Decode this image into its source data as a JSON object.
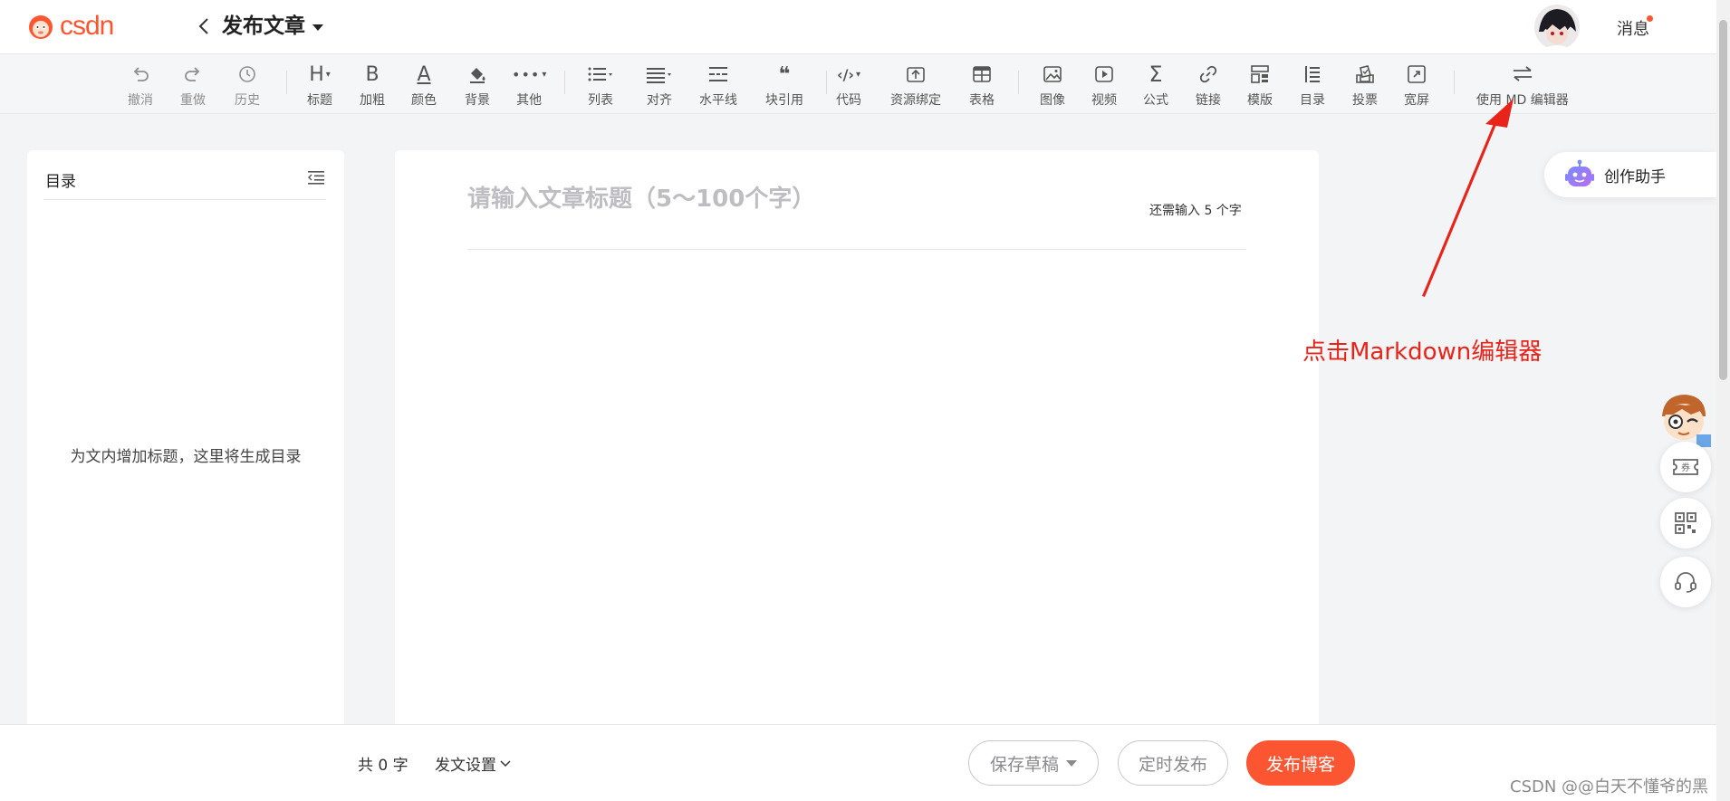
{
  "header": {
    "logo_text": "CSDN",
    "page_title": "发布文章",
    "messages_label": "消息"
  },
  "toolbar": [
    {
      "name": "undo",
      "label": "撤消",
      "icon": "undo-icon",
      "disabled": true
    },
    {
      "name": "redo",
      "label": "重做",
      "icon": "redo-icon",
      "disabled": true
    },
    {
      "name": "history",
      "label": "历史",
      "icon": "history-icon",
      "disabled": true
    },
    {
      "name": "heading",
      "label": "标题",
      "icon": "heading-icon",
      "glyph": "H",
      "dropdown": true
    },
    {
      "name": "bold",
      "label": "加粗",
      "icon": "bold-icon",
      "glyph": "B"
    },
    {
      "name": "color",
      "label": "颜色",
      "icon": "text-color-icon",
      "glyph": "A"
    },
    {
      "name": "background",
      "label": "背景",
      "icon": "paint-bucket-icon"
    },
    {
      "name": "other",
      "label": "其他",
      "icon": "more-icon",
      "glyph": "•••",
      "dropdown": true
    },
    {
      "name": "list",
      "label": "列表",
      "icon": "list-icon",
      "dropdown": true
    },
    {
      "name": "align",
      "label": "对齐",
      "icon": "align-icon",
      "dropdown": true
    },
    {
      "name": "hr",
      "label": "水平线",
      "icon": "horizontal-rule-icon"
    },
    {
      "name": "blockquote",
      "label": "块引用",
      "icon": "quote-icon",
      "glyph": "❝"
    },
    {
      "name": "code",
      "label": "代码",
      "icon": "code-icon",
      "glyph": "‹/›",
      "dropdown": true
    },
    {
      "name": "resource",
      "label": "资源绑定",
      "icon": "resource-upload-icon"
    },
    {
      "name": "table",
      "label": "表格",
      "icon": "table-icon"
    },
    {
      "name": "image",
      "label": "图像",
      "icon": "image-icon"
    },
    {
      "name": "video",
      "label": "视频",
      "icon": "video-icon"
    },
    {
      "name": "formula",
      "label": "公式",
      "icon": "sigma-icon",
      "glyph": "Σ"
    },
    {
      "name": "link",
      "label": "链接",
      "icon": "link-icon"
    },
    {
      "name": "template",
      "label": "模版",
      "icon": "template-icon"
    },
    {
      "name": "toc",
      "label": "目录",
      "icon": "toc-icon"
    },
    {
      "name": "vote",
      "label": "投票",
      "icon": "vote-icon"
    },
    {
      "name": "wide",
      "label": "宽屏",
      "icon": "fullscreen-icon"
    },
    {
      "name": "md-editor",
      "label": "使用 MD 编辑器",
      "icon": "switch-editor-icon",
      "glyph": "⇋"
    }
  ],
  "toc_panel": {
    "title": "目录",
    "empty_text": "为文内增加标题，这里将生成目录"
  },
  "editor": {
    "title_placeholder": "请输入文章标题（5～100个字）",
    "remaining_hint": "还需输入 5 个字"
  },
  "assistant": {
    "label": "创作助手"
  },
  "annotation": {
    "text": "点击Markdown编辑器",
    "color": "#e8241a"
  },
  "footer": {
    "word_count": "共 0 字",
    "settings_label": "发文设置",
    "save_draft": "保存草稿",
    "schedule": "定时发布",
    "publish": "发布博客"
  },
  "watermark": "CSDN @@白天不懂爷的黑",
  "colors": {
    "brand": "#fc5531",
    "annotation": "#e8241a"
  }
}
